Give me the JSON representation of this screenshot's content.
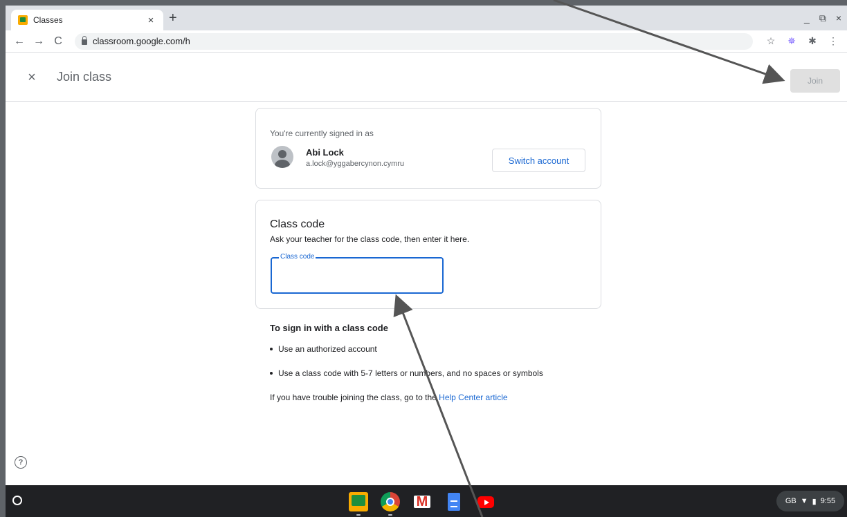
{
  "browser": {
    "tab_title": "Classes",
    "tab_close": "×",
    "new_tab": "+",
    "url": "classroom.google.com/h",
    "window_controls": [
      "_",
      "⧉",
      "×"
    ],
    "nav": {
      "back": "←",
      "forward": "→",
      "reload": "C"
    },
    "toolbar_icons": [
      "☆",
      "✵",
      "✱",
      "⋮"
    ]
  },
  "header": {
    "close": "×",
    "title": "Join class",
    "join_label": "Join"
  },
  "account": {
    "signed_in_label": "You're currently signed in as",
    "name": "Abi Lock",
    "email": "a.lock@yggabercynon.cymru",
    "switch_label": "Switch account"
  },
  "class_code": {
    "title": "Class code",
    "description": "Ask your teacher for the class code, then enter it here.",
    "field_label": "Class code",
    "value": ""
  },
  "help": {
    "title": "To sign in with a class code",
    "items": [
      "Use an authorized account",
      "Use a class code with 5-7 letters or numbers, and no spaces or symbols"
    ],
    "footer_prefix": "If you have trouble joining the class, go to the ",
    "footer_link": "Help Center article",
    "help_icon": "?"
  },
  "shelf": {
    "status": {
      "locale": "GB",
      "wifi": "▼",
      "battery": "▮",
      "time": "9:55"
    }
  },
  "colors": {
    "accent": "#1967d2",
    "join_disabled_bg": "#e0e0e0",
    "shelf_bg": "#202124"
  }
}
